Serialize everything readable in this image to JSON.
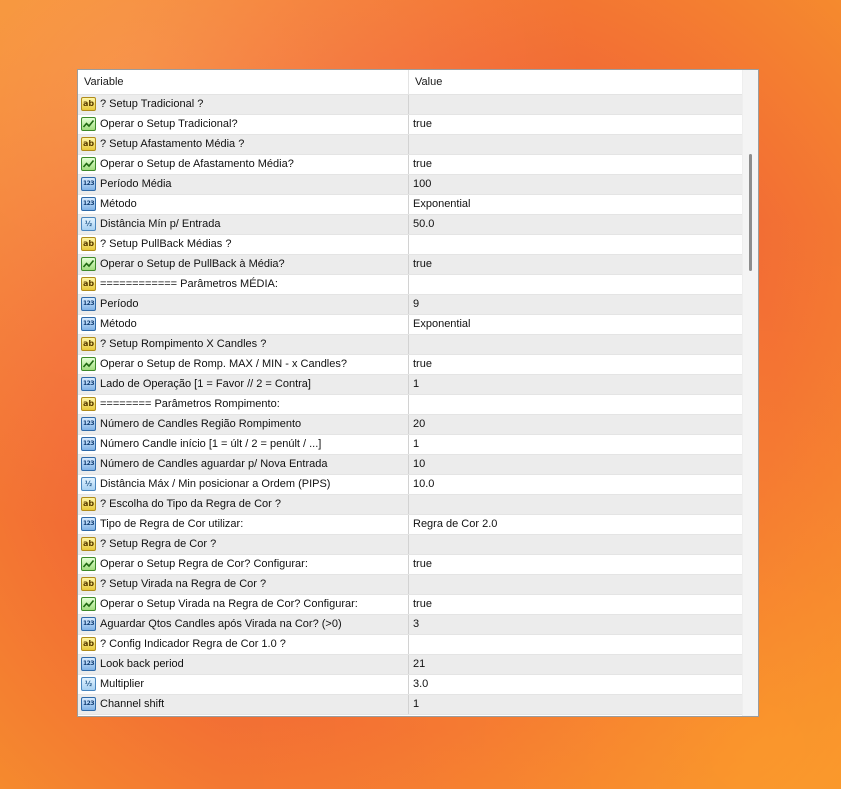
{
  "header": {
    "variable": "Variable",
    "value": "Value"
  },
  "icons": {
    "str": "ab",
    "int": "123",
    "dbl": "½",
    "bool": "checkmark-icon"
  },
  "colors": {
    "alt_row": "#ececec",
    "border": "#9c9c9c"
  },
  "rows": [
    {
      "type": "str",
      "name": "? Setup Tradicional ?",
      "value": ""
    },
    {
      "type": "bool",
      "name": "Operar o Setup Tradicional?",
      "value": "true"
    },
    {
      "type": "str",
      "name": "? Setup Afastamento Média ?",
      "value": ""
    },
    {
      "type": "bool",
      "name": "Operar o Setup de Afastamento Média?",
      "value": "true"
    },
    {
      "type": "int",
      "name": "Período Média",
      "value": "100"
    },
    {
      "type": "int",
      "name": "Método",
      "value": "Exponential"
    },
    {
      "type": "dbl",
      "name": "Distância Mín p/ Entrada",
      "value": "50.0"
    },
    {
      "type": "str",
      "name": "? Setup PullBack Médias ?",
      "value": ""
    },
    {
      "type": "bool",
      "name": "Operar o Setup de PullBack à Média?",
      "value": "true"
    },
    {
      "type": "str",
      "name": "============ Parâmetros MÉDIA:",
      "value": ""
    },
    {
      "type": "int",
      "name": "Período",
      "value": "9"
    },
    {
      "type": "int",
      "name": "Método",
      "value": "Exponential"
    },
    {
      "type": "str",
      "name": "? Setup Rompimento X Candles ?",
      "value": ""
    },
    {
      "type": "bool",
      "name": "Operar o Setup de Romp. MAX / MIN - x Candles?",
      "value": "true"
    },
    {
      "type": "int",
      "name": "Lado de Operação [1 = Favor // 2 = Contra]",
      "value": "1"
    },
    {
      "type": "str",
      "name": "======== Parâmetros Rompimento:",
      "value": ""
    },
    {
      "type": "int",
      "name": "Número de Candles Região Rompimento",
      "value": "20"
    },
    {
      "type": "int",
      "name": "Número Candle início [1 = últ / 2 = penúlt / ...]",
      "value": "1"
    },
    {
      "type": "int",
      "name": "Número de Candles aguardar p/ Nova Entrada",
      "value": "10"
    },
    {
      "type": "dbl",
      "name": "Distância Máx / Min posicionar a Ordem (PIPS)",
      "value": "10.0"
    },
    {
      "type": "str",
      "name": "? Escolha do Tipo da Regra de Cor ?",
      "value": ""
    },
    {
      "type": "int",
      "name": "Tipo de Regra de Cor utilizar:",
      "value": "Regra de Cor 2.0"
    },
    {
      "type": "str",
      "name": "? Setup Regra de Cor ?",
      "value": ""
    },
    {
      "type": "bool",
      "name": "Operar o Setup Regra de Cor? Configurar:",
      "value": "true"
    },
    {
      "type": "str",
      "name": "? Setup Virada na Regra de Cor ?",
      "value": ""
    },
    {
      "type": "bool",
      "name": "Operar o Setup Virada na Regra de Cor? Configurar:",
      "value": "true"
    },
    {
      "type": "int",
      "name": "Aguardar Qtos Candles após Virada na Cor? (>0)",
      "value": "3"
    },
    {
      "type": "str",
      "name": "? Config Indicador Regra de Cor 1.0 ?",
      "value": ""
    },
    {
      "type": "int",
      "name": "Look back period",
      "value": "21"
    },
    {
      "type": "dbl",
      "name": "Multiplier",
      "value": "3.0"
    },
    {
      "type": "int",
      "name": "Channel shift",
      "value": "1"
    }
  ]
}
